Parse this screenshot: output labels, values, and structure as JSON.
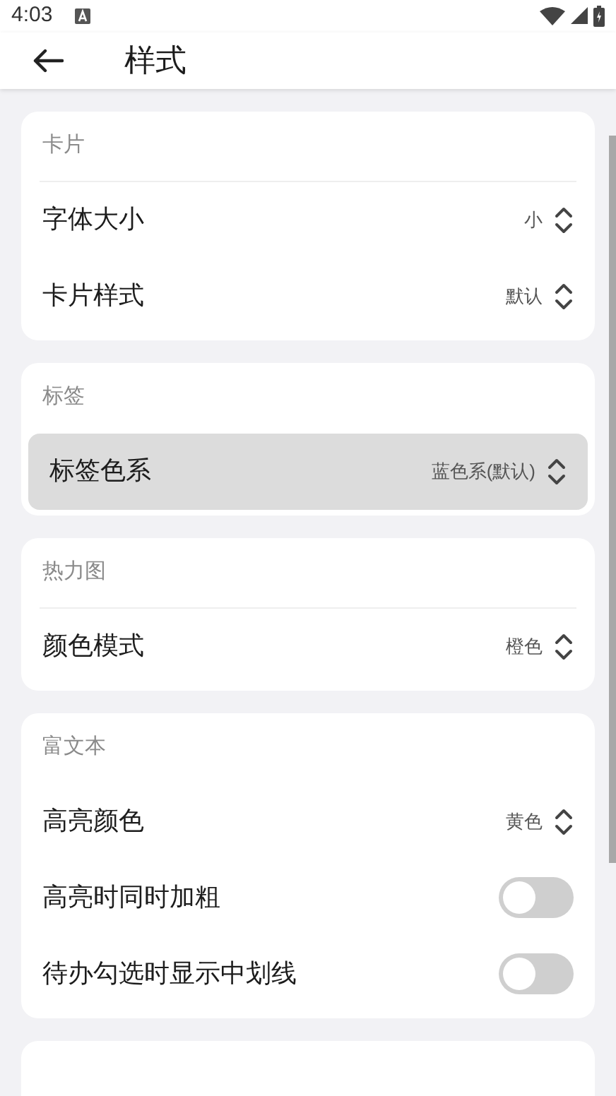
{
  "status_bar": {
    "time": "4:03"
  },
  "app_bar": {
    "title": "样式"
  },
  "sections": [
    {
      "title": "卡片",
      "divider": true,
      "rows": [
        {
          "kind": "select",
          "label": "字体大小",
          "value": "小",
          "pressed": false
        },
        {
          "kind": "select",
          "label": "卡片样式",
          "value": "默认",
          "pressed": false
        }
      ]
    },
    {
      "title": "标签",
      "divider": false,
      "rows": [
        {
          "kind": "select",
          "label": "标签色系",
          "value": "蓝色系(默认)",
          "pressed": true
        }
      ]
    },
    {
      "title": "热力图",
      "divider": true,
      "rows": [
        {
          "kind": "select",
          "label": "颜色模式",
          "value": "橙色",
          "pressed": false
        }
      ]
    },
    {
      "title": "富文本",
      "divider": false,
      "rows": [
        {
          "kind": "select",
          "label": "高亮颜色",
          "value": "黄色",
          "pressed": false
        },
        {
          "kind": "toggle",
          "label": "高亮时同时加粗",
          "on": false,
          "pressed": false
        },
        {
          "kind": "toggle",
          "label": "待办勾选时显示中划线",
          "on": false,
          "pressed": false
        }
      ]
    }
  ]
}
